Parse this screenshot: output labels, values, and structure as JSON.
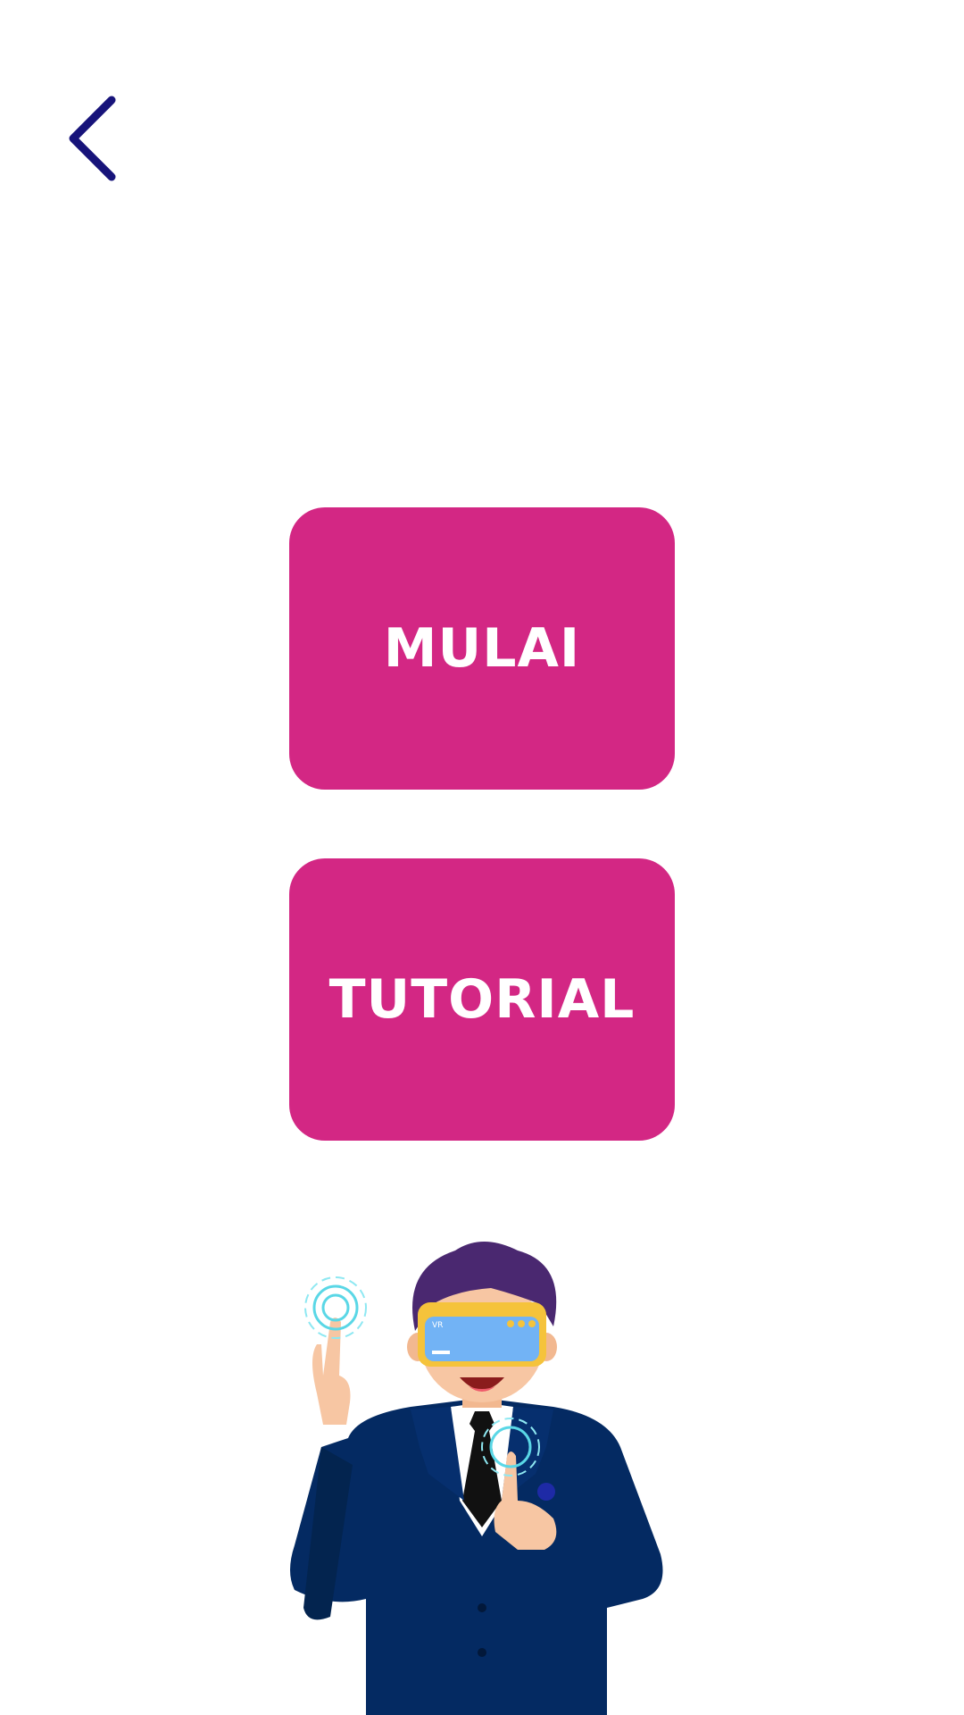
{
  "header": {
    "back_icon": "chevron-left-icon",
    "back_color": "#17137a"
  },
  "menu": {
    "start_label": "MULAI",
    "tutorial_label": "TUTORIAL",
    "button_color": "#d32784"
  },
  "illustration": {
    "subject": "vr-presenter-character",
    "headset_text": "VR"
  }
}
